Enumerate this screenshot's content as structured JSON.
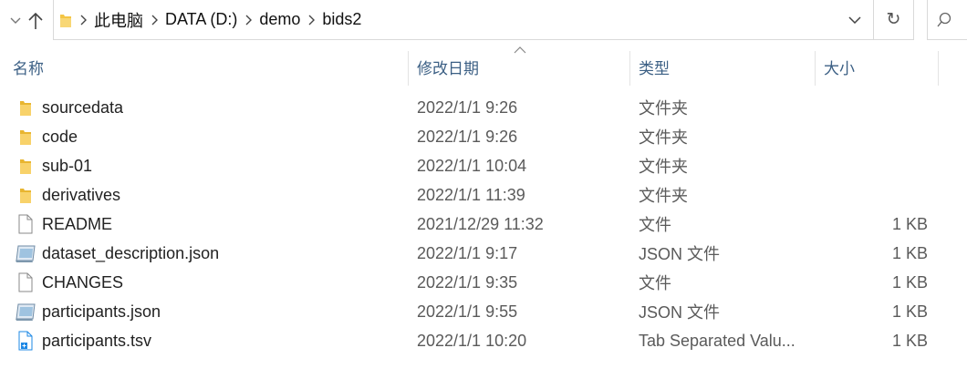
{
  "nav": {
    "up_icon": "arrow-up-icon",
    "breadcrumbs": [
      "此电脑",
      "DATA (D:)",
      "demo",
      "bids2"
    ]
  },
  "columns": {
    "name": "名称",
    "date": "修改日期",
    "type": "类型",
    "size": "大小"
  },
  "files": [
    {
      "name": "sourcedata",
      "date": "2022/1/1 9:26",
      "type": "文件夹",
      "size": "",
      "icon": "folder-icon"
    },
    {
      "name": "code",
      "date": "2022/1/1 9:26",
      "type": "文件夹",
      "size": "",
      "icon": "folder-icon"
    },
    {
      "name": "sub-01",
      "date": "2022/1/1 10:04",
      "type": "文件夹",
      "size": "",
      "icon": "folder-icon"
    },
    {
      "name": "derivatives",
      "date": "2022/1/1 11:39",
      "type": "文件夹",
      "size": "",
      "icon": "folder-icon"
    },
    {
      "name": "README",
      "date": "2021/12/29 11:32",
      "type": "文件",
      "size": "1 KB",
      "icon": "file-icon"
    },
    {
      "name": "dataset_description.json",
      "date": "2022/1/1 9:17",
      "type": "JSON 文件",
      "size": "1 KB",
      "icon": "json-file-icon"
    },
    {
      "name": "CHANGES",
      "date": "2022/1/1 9:35",
      "type": "文件",
      "size": "1 KB",
      "icon": "file-icon"
    },
    {
      "name": "participants.json",
      "date": "2022/1/1 9:55",
      "type": "JSON 文件",
      "size": "1 KB",
      "icon": "json-file-icon"
    },
    {
      "name": "participants.tsv",
      "date": "2022/1/1 10:20",
      "type": "Tab Separated Valu...",
      "size": "1 KB",
      "icon": "tsv-file-icon"
    }
  ],
  "colors": {
    "folder": "#f4c544",
    "header_text": "#3b5f84",
    "secondary_text": "#5a5a5a",
    "tsv_icon": "#1e88e5"
  }
}
